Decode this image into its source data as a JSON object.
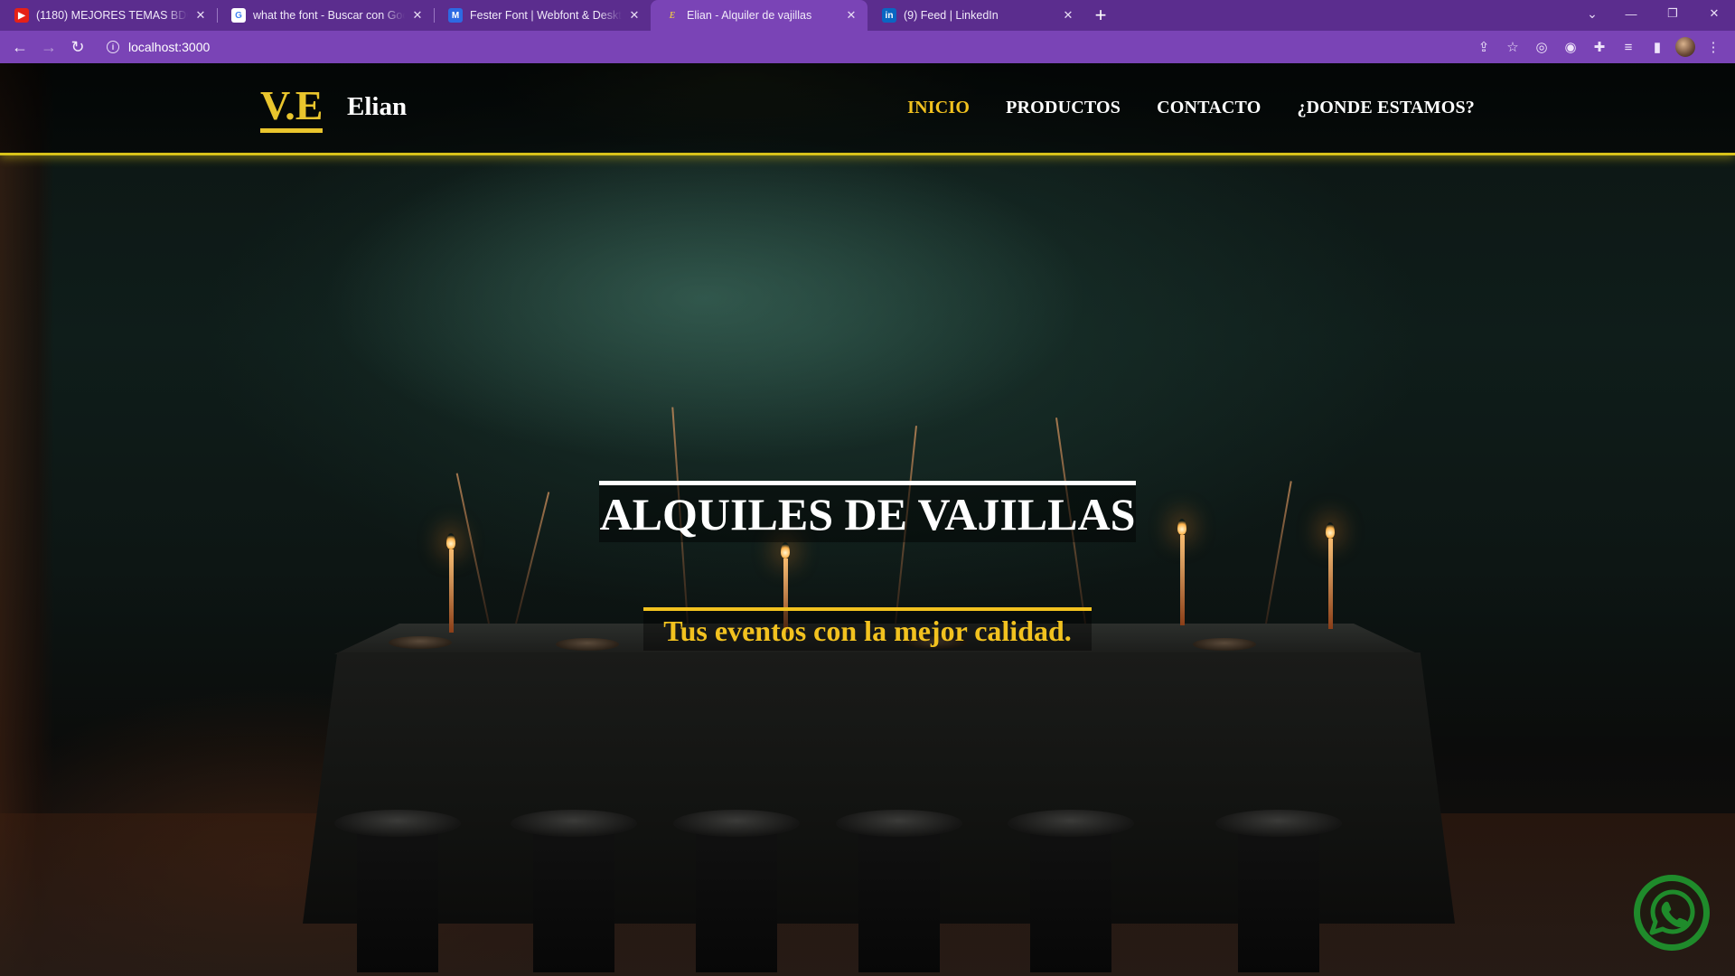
{
  "browser": {
    "tabs": [
      {
        "title": "(1180) MEJORES TEMAS BDC GA",
        "favicon": "youtube-icon",
        "active": false
      },
      {
        "title": "what the font - Buscar con Google",
        "favicon": "google-icon",
        "active": false
      },
      {
        "title": "Fester Font | Webfont & Desktop",
        "favicon": "myfonts-icon",
        "active": false
      },
      {
        "title": "Elian - Alquiler de vajillas",
        "favicon": "site-e-icon",
        "active": true
      },
      {
        "title": "(9) Feed | LinkedIn",
        "favicon": "linkedin-icon",
        "active": false
      }
    ],
    "address": "localhost:3000",
    "theme_color": "#7a44b6"
  },
  "site": {
    "logo_mark": "V.E",
    "logo_name": "Elian",
    "nav": [
      {
        "label": "INICIO",
        "active": true
      },
      {
        "label": "PRODUCTOS",
        "active": false
      },
      {
        "label": "CONTACTO",
        "active": false
      },
      {
        "label": "¿DONDE ESTAMOS?",
        "active": false
      }
    ],
    "accent": "#f2c21f"
  },
  "hero": {
    "title": "ALQUILES DE VAJILLAS",
    "subtitle": "Tus eventos con la mejor calidad."
  },
  "floating": {
    "whatsapp_icon": "whatsapp-icon",
    "whatsapp_color": "#1f8b2b"
  }
}
